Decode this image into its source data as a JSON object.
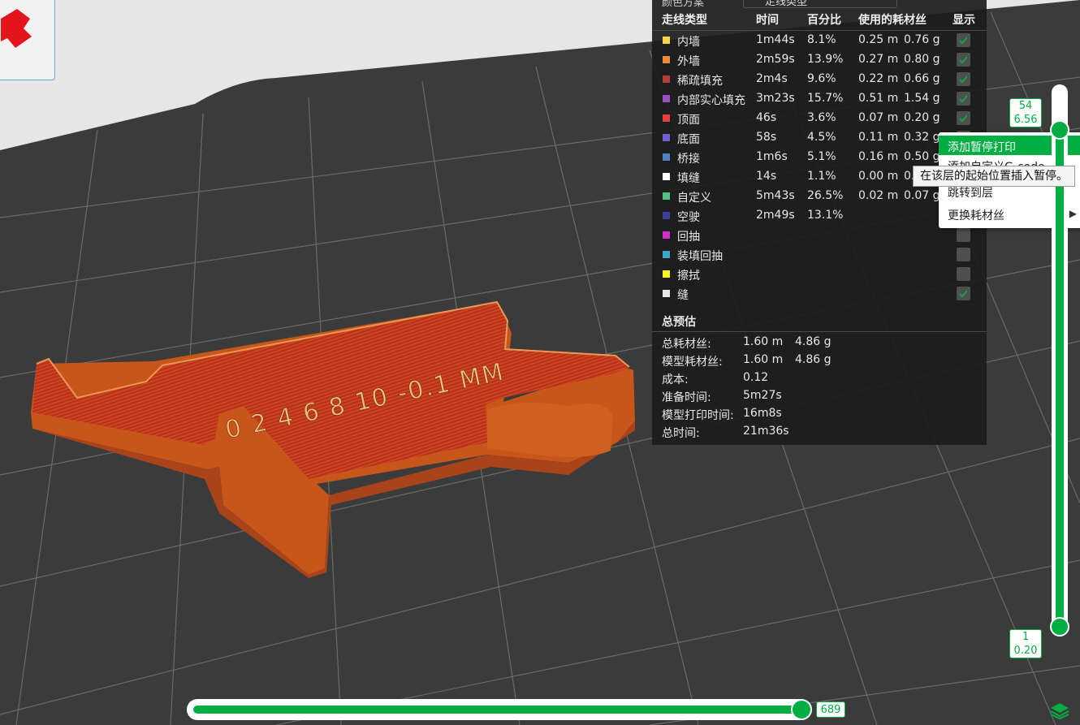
{
  "legend": {
    "scheme_label": "颜色方案",
    "scheme_value": "走线类型",
    "headers": [
      "走线类型",
      "时间",
      "百分比",
      "使用的耗材丝",
      "显示"
    ],
    "rows": [
      {
        "color": "#f5d547",
        "name": "内墙",
        "time": "1m44s",
        "pct": "8.1%",
        "len": "0.25 m",
        "wt": "0.76 g",
        "shown": true
      },
      {
        "color": "#ef8a3c",
        "name": "外墙",
        "time": "2m59s",
        "pct": "13.9%",
        "len": "0.27 m",
        "wt": "0.80 g",
        "shown": true
      },
      {
        "color": "#b83a34",
        "name": "稀疏填充",
        "time": "2m4s",
        "pct": "9.6%",
        "len": "0.22 m",
        "wt": "0.66 g",
        "shown": true
      },
      {
        "color": "#9a4fc6",
        "name": "内部实心填充",
        "time": "3m23s",
        "pct": "15.7%",
        "len": "0.51 m",
        "wt": "1.54 g",
        "shown": true
      },
      {
        "color": "#ea3f3f",
        "name": "顶面",
        "time": "46s",
        "pct": "3.6%",
        "len": "0.07 m",
        "wt": "0.20 g",
        "shown": true
      },
      {
        "color": "#6c5fd0",
        "name": "底面",
        "time": "58s",
        "pct": "4.5%",
        "len": "0.11 m",
        "wt": "0.32 g",
        "shown": true
      },
      {
        "color": "#4f82c4",
        "name": "桥接",
        "time": "1m6s",
        "pct": "5.1%",
        "len": "0.16 m",
        "wt": "0.50 g",
        "shown": true
      },
      {
        "color": "#ffffff",
        "name": "填缝",
        "time": "14s",
        "pct": "1.1%",
        "len": "0.00 m",
        "wt": "0.",
        "shown": true
      },
      {
        "color": "#4ec481",
        "name": "自定义",
        "time": "5m43s",
        "pct": "26.5%",
        "len": "0.02 m",
        "wt": "0.07 g",
        "shown": true
      },
      {
        "color": "#3a3fa0",
        "name": "空驶",
        "time": "2m49s",
        "pct": "13.1%",
        "len": "",
        "wt": "",
        "shown": false
      },
      {
        "color": "#d32bd0",
        "name": "回抽",
        "time": "",
        "pct": "",
        "len": "",
        "wt": "",
        "shown": false
      },
      {
        "color": "#3aa8c9",
        "name": "装填回抽",
        "time": "",
        "pct": "",
        "len": "",
        "wt": "",
        "shown": false
      },
      {
        "color": "#f5f51f",
        "name": "擦拭",
        "time": "",
        "pct": "",
        "len": "",
        "wt": "",
        "shown": false
      },
      {
        "color": "#e5e5e5",
        "name": "缝",
        "time": "",
        "pct": "",
        "len": "",
        "wt": "",
        "shown": true
      }
    ]
  },
  "summary": {
    "title": "总预估",
    "rows": [
      {
        "k": "总耗材丝:",
        "v1": "1.60 m",
        "v2": "4.86 g"
      },
      {
        "k": "模型耗材丝:",
        "v1": "1.60 m",
        "v2": "4.86 g"
      },
      {
        "k": "成本:",
        "v1": "0.12",
        "v2": ""
      },
      {
        "k": "准备时间:",
        "v1": "5m27s",
        "v2": ""
      },
      {
        "k": "模型打印时间:",
        "v1": "16m8s",
        "v2": ""
      },
      {
        "k": "总时间:",
        "v1": "21m36s",
        "v2": ""
      }
    ]
  },
  "context_menu": {
    "items": [
      "添加暂停打印",
      "添加自定义G-code",
      "跳转到层",
      "更换耗材丝"
    ],
    "tooltip": "在该层的起始位置插入暂停。"
  },
  "vertical_slider": {
    "top_layer": "54",
    "top_height": "6.56",
    "bottom_layer": "1",
    "bottom_height": "0.20"
  },
  "horizontal_slider": {
    "value": "689"
  },
  "model_text": "0 2 4 6 8 10  -0.1 MM",
  "colors": {
    "accent": "#00ae42",
    "bed": "#3b3b3b",
    "model": "#c8561b"
  }
}
